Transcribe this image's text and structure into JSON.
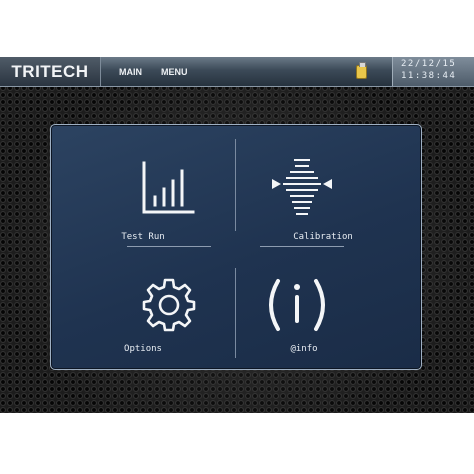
{
  "topbar": {
    "logo": "TRITECH",
    "menus": [
      "MAIN",
      "MENU"
    ],
    "usb_icon": "usb-drive-icon",
    "date": "22/12/15",
    "time": "11:38:44"
  },
  "tiles": [
    {
      "label": "Test Run",
      "icon": "bar-chart-icon"
    },
    {
      "label": "Calibration",
      "icon": "calibration-icon"
    },
    {
      "label": "Options",
      "icon": "gear-icon"
    },
    {
      "label": "@info",
      "icon": "info-icon"
    }
  ],
  "colors": {
    "panel_bg": "#1f3350",
    "panel_border": "#9fb0c3",
    "topbar": "#3c4a58",
    "text": "#e8edf3"
  }
}
